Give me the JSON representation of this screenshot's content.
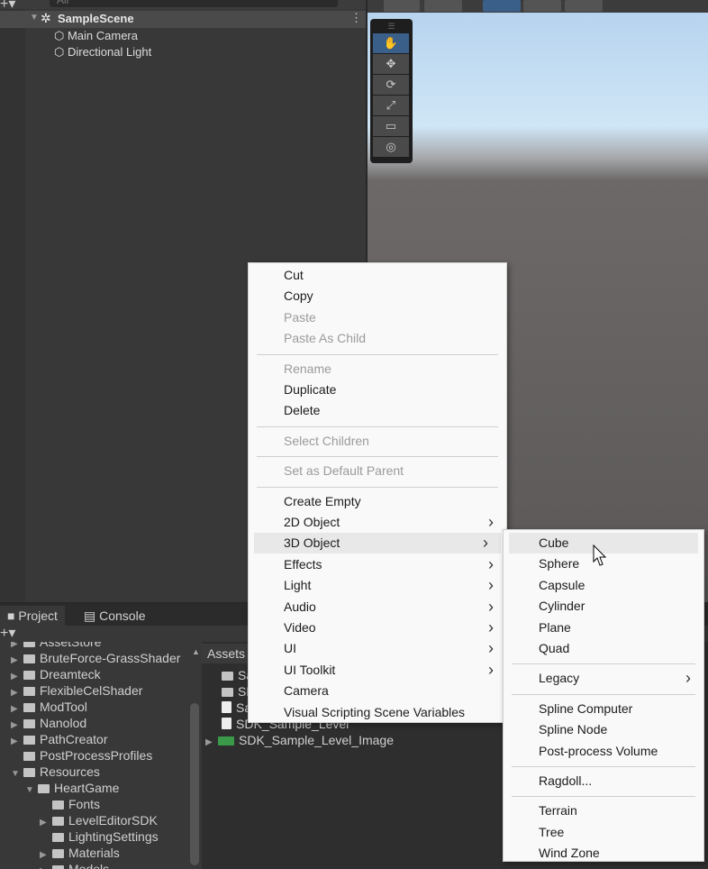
{
  "hierarchy": {
    "search_placeholder": "All",
    "scene": "SampleScene",
    "items": [
      "Main Camera",
      "Directional Light"
    ]
  },
  "scene_tools": [
    "hand-tool",
    "move-tool",
    "rotate-tool",
    "scale-tool",
    "rect-tool",
    "transform-tool"
  ],
  "project": {
    "tabs": [
      "Project",
      "Console"
    ],
    "breadcrumb": "Assets",
    "tree": [
      {
        "label": "AssetStore",
        "indent": 0,
        "arrow": true
      },
      {
        "label": "BruteForce-GrassShader",
        "indent": 0,
        "arrow": true
      },
      {
        "label": "Dreamteck",
        "indent": 0,
        "arrow": true
      },
      {
        "label": "FlexibleCelShader",
        "indent": 0,
        "arrow": true
      },
      {
        "label": "ModTool",
        "indent": 0,
        "arrow": true
      },
      {
        "label": "Nanolod",
        "indent": 0,
        "arrow": true
      },
      {
        "label": "PathCreator",
        "indent": 0,
        "arrow": true
      },
      {
        "label": "PostProcessProfiles",
        "indent": 0,
        "arrow": false
      },
      {
        "label": "Resources",
        "indent": 0,
        "arrow": "open"
      },
      {
        "label": "HeartGame",
        "indent": 1,
        "arrow": "open"
      },
      {
        "label": "Fonts",
        "indent": 2,
        "arrow": false
      },
      {
        "label": "LevelEditorSDK",
        "indent": 2,
        "arrow": true
      },
      {
        "label": "LightingSettings",
        "indent": 2,
        "arrow": false
      },
      {
        "label": "Materials",
        "indent": 2,
        "arrow": true
      },
      {
        "label": "Models",
        "indent": 2,
        "arrow": true
      }
    ],
    "assets": [
      "Sa",
      "SD",
      "Sa",
      "SDK_Sample_Level",
      "SDK_Sample_Level_Image"
    ]
  },
  "context_menu": [
    {
      "label": "Cut"
    },
    {
      "label": "Copy"
    },
    {
      "label": "Paste",
      "disabled": true
    },
    {
      "label": "Paste As Child",
      "disabled": true
    },
    {
      "sep": true
    },
    {
      "label": "Rename",
      "disabled": true
    },
    {
      "label": "Duplicate"
    },
    {
      "label": "Delete"
    },
    {
      "sep": true
    },
    {
      "label": "Select Children",
      "disabled": true
    },
    {
      "sep": true
    },
    {
      "label": "Set as Default Parent",
      "disabled": true
    },
    {
      "sep": true
    },
    {
      "label": "Create Empty"
    },
    {
      "label": "2D Object",
      "sub": true
    },
    {
      "label": "3D Object",
      "sub": true,
      "active": true
    },
    {
      "label": "Effects",
      "sub": true
    },
    {
      "label": "Light",
      "sub": true
    },
    {
      "label": "Audio",
      "sub": true
    },
    {
      "label": "Video",
      "sub": true
    },
    {
      "label": "UI",
      "sub": true
    },
    {
      "label": "UI Toolkit",
      "sub": true
    },
    {
      "label": "Camera"
    },
    {
      "label": "Visual Scripting Scene Variables"
    }
  ],
  "submenu": [
    {
      "label": "Cube",
      "active": true
    },
    {
      "label": "Sphere"
    },
    {
      "label": "Capsule"
    },
    {
      "label": "Cylinder"
    },
    {
      "label": "Plane"
    },
    {
      "label": "Quad"
    },
    {
      "sep": true
    },
    {
      "label": "Legacy",
      "sub": true
    },
    {
      "sep": true
    },
    {
      "label": "Spline Computer"
    },
    {
      "label": "Spline Node"
    },
    {
      "label": "Post-process Volume"
    },
    {
      "sep": true
    },
    {
      "label": "Ragdoll..."
    },
    {
      "sep": true
    },
    {
      "label": "Terrain"
    },
    {
      "label": "Tree"
    },
    {
      "label": "Wind Zone"
    }
  ]
}
